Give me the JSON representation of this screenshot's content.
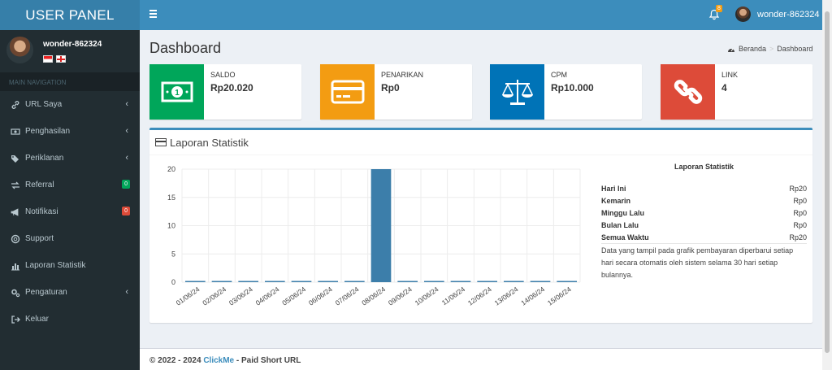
{
  "app": {
    "logo": "USER PANEL",
    "username": "wonder-862324",
    "notification_count": "8"
  },
  "sidebar": {
    "nav_header": "MAIN NAVIGATION",
    "items": [
      {
        "label": "URL Saya",
        "icon": "link-icon",
        "chevron": true
      },
      {
        "label": "Penghasilan",
        "icon": "money-icon",
        "chevron": true
      },
      {
        "label": "Periklanan",
        "icon": "tags-icon",
        "chevron": true
      },
      {
        "label": "Referral",
        "icon": "exchange-icon",
        "badge": "0",
        "badge_color": "#00a65a"
      },
      {
        "label": "Notifikasi",
        "icon": "bullhorn-icon",
        "badge": "0",
        "badge_color": "#dd4b39"
      },
      {
        "label": "Support",
        "icon": "lifebuoy-icon"
      },
      {
        "label": "Laporan Statistik",
        "icon": "bar-chart-icon"
      },
      {
        "label": "Pengaturan",
        "icon": "cogs-icon",
        "chevron": true
      },
      {
        "label": "Keluar",
        "icon": "sign-out-icon"
      }
    ]
  },
  "page": {
    "title": "Dashboard",
    "breadcrumb": [
      "Beranda",
      "Dashboard"
    ]
  },
  "info_boxes": [
    {
      "label": "SALDO",
      "value": "Rp20.020",
      "color": "#00a65a",
      "icon": "money-bill-icon"
    },
    {
      "label": "PENARIKAN",
      "value": "Rp0",
      "color": "#f39c12",
      "icon": "credit-card-icon"
    },
    {
      "label": "CPM",
      "value": "Rp10.000",
      "color": "#0073b7",
      "icon": "balance-scale-icon"
    },
    {
      "label": "LINK",
      "value": "4",
      "color": "#dd4b39",
      "icon": "chain-link-icon"
    }
  ],
  "report": {
    "title": "Laporan Statistik",
    "stats_title": "Laporan Statistik",
    "rows": [
      {
        "label": "Hari Ini",
        "value": "Rp20"
      },
      {
        "label": "Kemarin",
        "value": "Rp0"
      },
      {
        "label": "Minggu Lalu",
        "value": "Rp0"
      },
      {
        "label": "Bulan Lalu",
        "value": "Rp0"
      },
      {
        "label": "Semua Waktu",
        "value": "Rp20"
      }
    ],
    "note": "Data yang tampil pada grafik pembayaran diperbarui setiap hari secara otomatis oleh sistem selama 30 hari setiap bulannya."
  },
  "chart_data": {
    "type": "bar",
    "categories": [
      "01/06/24",
      "02/06/24",
      "03/06/24",
      "04/06/24",
      "05/06/24",
      "06/06/24",
      "07/06/24",
      "08/06/24",
      "09/06/24",
      "10/06/24",
      "11/06/24",
      "12/06/24",
      "13/06/24",
      "14/06/24",
      "15/06/24"
    ],
    "values": [
      0,
      0,
      0,
      0,
      0,
      0,
      0,
      20,
      0,
      0,
      0,
      0,
      0,
      0,
      0
    ],
    "ylim": [
      0,
      20
    ],
    "yticks": [
      0,
      5,
      10,
      15,
      20
    ],
    "grid": true,
    "bar_color": "#3c7eaa"
  },
  "footer": {
    "prefix": "© 2022 - 2024 ",
    "brand": "ClickMe",
    "suffix": " - Paid Short URL"
  }
}
